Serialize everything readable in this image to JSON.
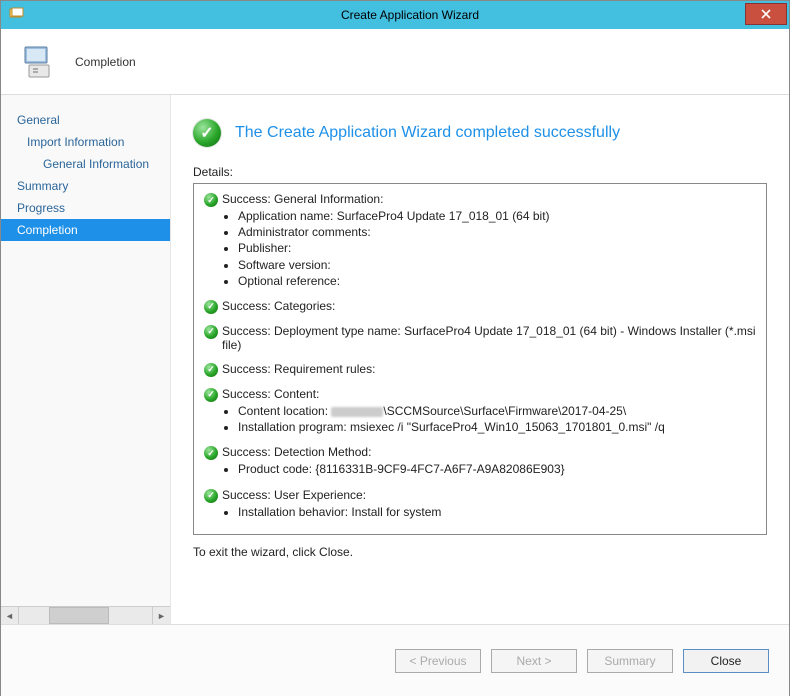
{
  "titlebar": {
    "title": "Create Application Wizard"
  },
  "header": {
    "title": "Completion"
  },
  "nav": {
    "general": "General",
    "import_info": "Import Information",
    "general_info": "General Information",
    "summary": "Summary",
    "progress": "Progress",
    "completion": "Completion"
  },
  "banner": {
    "text": "The Create Application Wizard completed successfully"
  },
  "details": {
    "label": "Details:",
    "sections": {
      "general_info": {
        "title": "Success: General Information:",
        "app_name": "Application name: SurfacePro4 Update 17_018_01 (64 bit)",
        "admin_comments": "Administrator comments:",
        "publisher": "Publisher:",
        "version": "Software version:",
        "optional_ref": "Optional reference:"
      },
      "categories": {
        "title": "Success: Categories:"
      },
      "deployment": {
        "title": "Success: Deployment type name: SurfacePro4 Update 17_018_01 (64 bit) - Windows Installer (*.msi file)"
      },
      "requirements": {
        "title": "Success: Requirement rules:"
      },
      "content": {
        "title": "Success: Content:",
        "location_prefix": "Content location: ",
        "location_suffix": "\\SCCMSource\\Surface\\Firmware\\2017-04-25\\",
        "install_prog": "Installation program: msiexec /i \"SurfacePro4_Win10_15063_1701801_0.msi\" /q"
      },
      "detection": {
        "title": "Success: Detection Method:",
        "product_code": "Product code: {8116331B-9CF9-4FC7-A6F7-A9A82086E903}"
      },
      "user_exp": {
        "title": "Success: User Experience:",
        "behavior": "Installation behavior: Install for system"
      }
    }
  },
  "exit_text": "To exit the wizard, click Close.",
  "buttons": {
    "previous": "< Previous",
    "next": "Next >",
    "summary": "Summary",
    "close": "Close"
  }
}
